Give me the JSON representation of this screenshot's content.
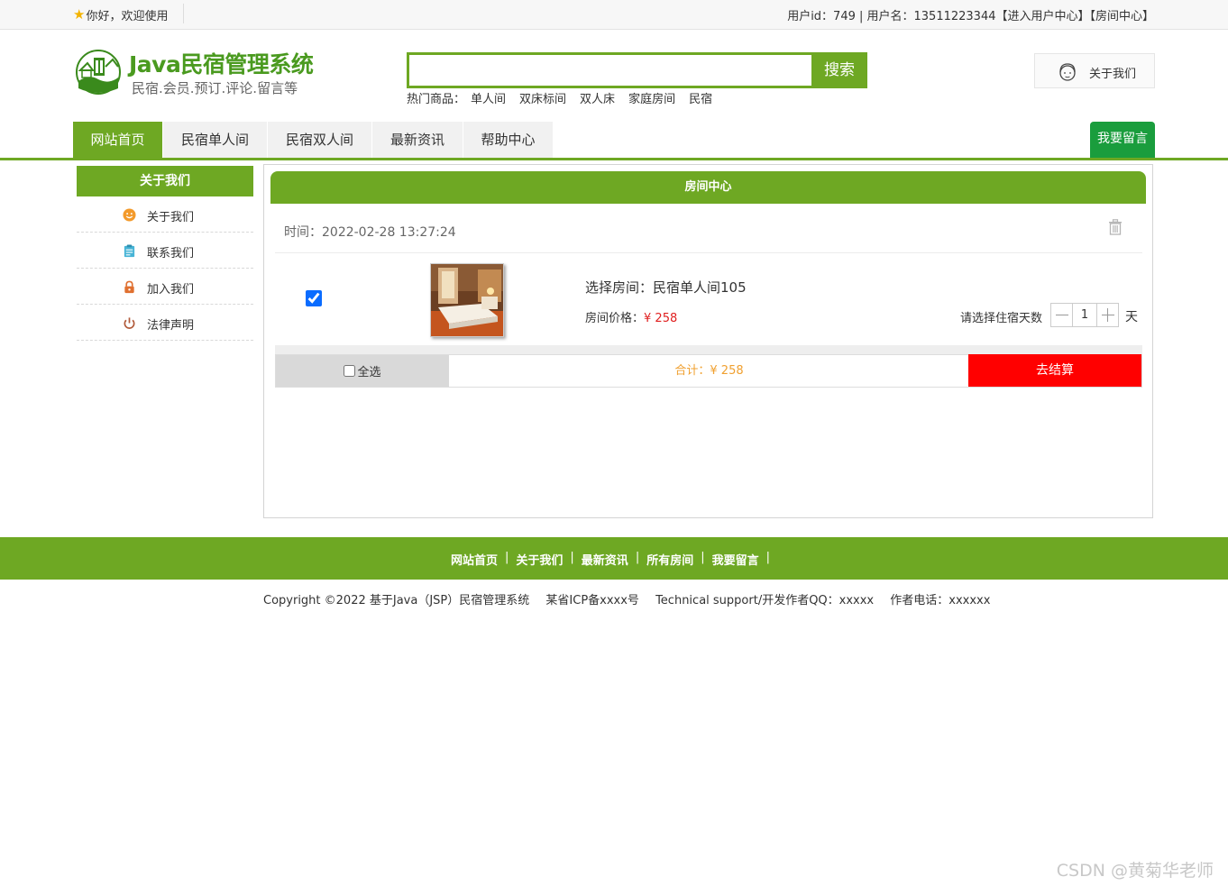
{
  "topbar": {
    "greeting": "你好，欢迎使用",
    "userinfo": "用户id：749 | 用户名：13511223344【进入用户中心】【房间中心】"
  },
  "logo": {
    "title": "Java民宿管理系统",
    "subtitle": "民宿.会员.预订.评论.留言等"
  },
  "search": {
    "value": "",
    "button_label": "搜索"
  },
  "hot": {
    "label": "热门商品：",
    "words": [
      "单人间",
      "双床标间",
      "双人床",
      "家庭房间",
      "民宿"
    ]
  },
  "about_box": {
    "label": "关于我们"
  },
  "nav": {
    "tabs": [
      {
        "label": "网站首页",
        "active": true
      },
      {
        "label": "民宿单人间",
        "active": false
      },
      {
        "label": "民宿双人间",
        "active": false
      },
      {
        "label": "最新资讯",
        "active": false
      },
      {
        "label": "帮助中心",
        "active": false
      }
    ],
    "message_button": "我要留言"
  },
  "sidebar": {
    "title": "关于我们",
    "items": [
      {
        "label": "关于我们",
        "icon": "smile-icon"
      },
      {
        "label": "联系我们",
        "icon": "clipboard-icon"
      },
      {
        "label": "加入我们",
        "icon": "lock-icon"
      },
      {
        "label": "法律声明",
        "icon": "power-icon"
      }
    ]
  },
  "panel": {
    "title": "房间中心",
    "time": "时间：2022-02-28 13:27:24",
    "room_name": "选择房间：民宿单人间105",
    "price_label": "房间价格：",
    "price_value": "¥ 258",
    "days_label": "请选择住宿天数",
    "days_value": "1",
    "days_unit": "天",
    "select_all": "全选",
    "total": "合计：¥ 258",
    "checkout": "去结算"
  },
  "footer": {
    "links": [
      "网站首页",
      "关于我们",
      "最新资讯",
      "所有房间",
      "我要留言"
    ],
    "separator": "|",
    "copyright": [
      "Copyright ©2022 基于Java（JSP）民宿管理系统",
      "某省ICP备xxxx号",
      "Technical support/开发作者QQ：xxxxx",
      "作者电话：xxxxxx"
    ]
  },
  "watermark": "CSDN @黄菊华老师",
  "colors": {
    "brand_green": "#6ea823",
    "message_green": "#1a9d3d",
    "checkout_red": "#ff0000",
    "price_red": "#e02020",
    "total_orange": "#f0a030"
  }
}
